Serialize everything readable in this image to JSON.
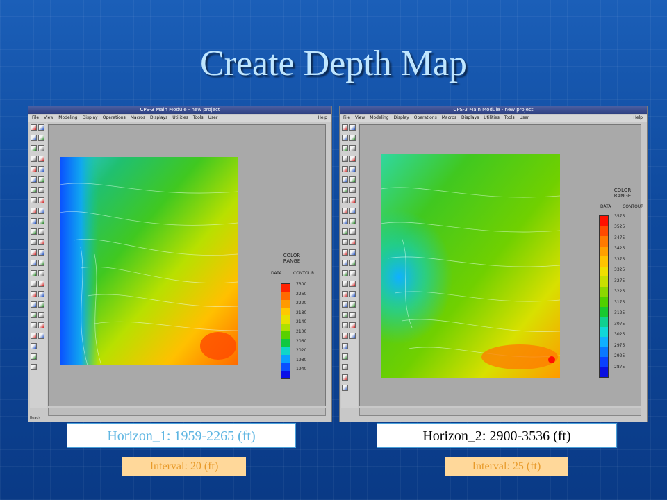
{
  "slide": {
    "title": "Create Depth Map",
    "colors": {
      "background": "#1352a8",
      "title": "#bfe6ff",
      "caption_left_text": "#5fb6e2",
      "caption_right_text": "#000000",
      "interval_text": "#e89a2a",
      "interval_bg": "#ffd89a"
    }
  },
  "left_window": {
    "title": "CPS-3 Main Module - new project",
    "menu": [
      "File",
      "View",
      "Modeling",
      "Display",
      "Operations",
      "Macros",
      "Displays",
      "Utilities",
      "Tools",
      "User"
    ],
    "help": "Help",
    "status": "Ready",
    "legend": {
      "title_lines": [
        "COLOR",
        "RANGE"
      ],
      "hdr_data": "DATA",
      "hdr_contour": "CONTOUR",
      "labels": [
        "7300",
        "2260",
        "2220",
        "2180",
        "2140",
        "2100",
        "2060",
        "2020",
        "1980",
        "1940"
      ],
      "colors": [
        "#ff2200",
        "#ff6a00",
        "#ff9a00",
        "#ffc800",
        "#e8e000",
        "#aee000",
        "#59d000",
        "#10c840",
        "#10d6c8",
        "#0aa0ff",
        "#0a50ff",
        "#0a10e8"
      ]
    }
  },
  "right_window": {
    "title": "CPS-3 Main Module - new project",
    "menu": [
      "File",
      "View",
      "Modeling",
      "Display",
      "Operations",
      "Macros",
      "Displays",
      "Utilities",
      "Tools",
      "User"
    ],
    "help": "Help",
    "legend": {
      "title_lines": [
        "COLOR",
        "RANGE"
      ],
      "hdr_data": "DATA",
      "hdr_contour": "CONTOUR",
      "labels": [
        "3575",
        "3525",
        "3475",
        "3425",
        "3375",
        "3325",
        "3275",
        "3225",
        "3175",
        "3125",
        "3075",
        "3025",
        "2975",
        "2925",
        "2875"
      ],
      "colors": [
        "#ff1000",
        "#ff4a00",
        "#ff7a00",
        "#ffa000",
        "#ffc400",
        "#f0e000",
        "#c8e000",
        "#8cd800",
        "#50d000",
        "#18c830",
        "#10d090",
        "#10d8d8",
        "#10b0ff",
        "#0a78ff",
        "#0a40ff",
        "#0a10e0"
      ]
    }
  },
  "captions": {
    "horizon_1": "Horizon_1: 1959-2265 (ft)",
    "horizon_2": "Horizon_2:  2900-3536 (ft)",
    "interval_1": "Interval: 20 (ft)",
    "interval_2": "Interval: 25 (ft)"
  }
}
